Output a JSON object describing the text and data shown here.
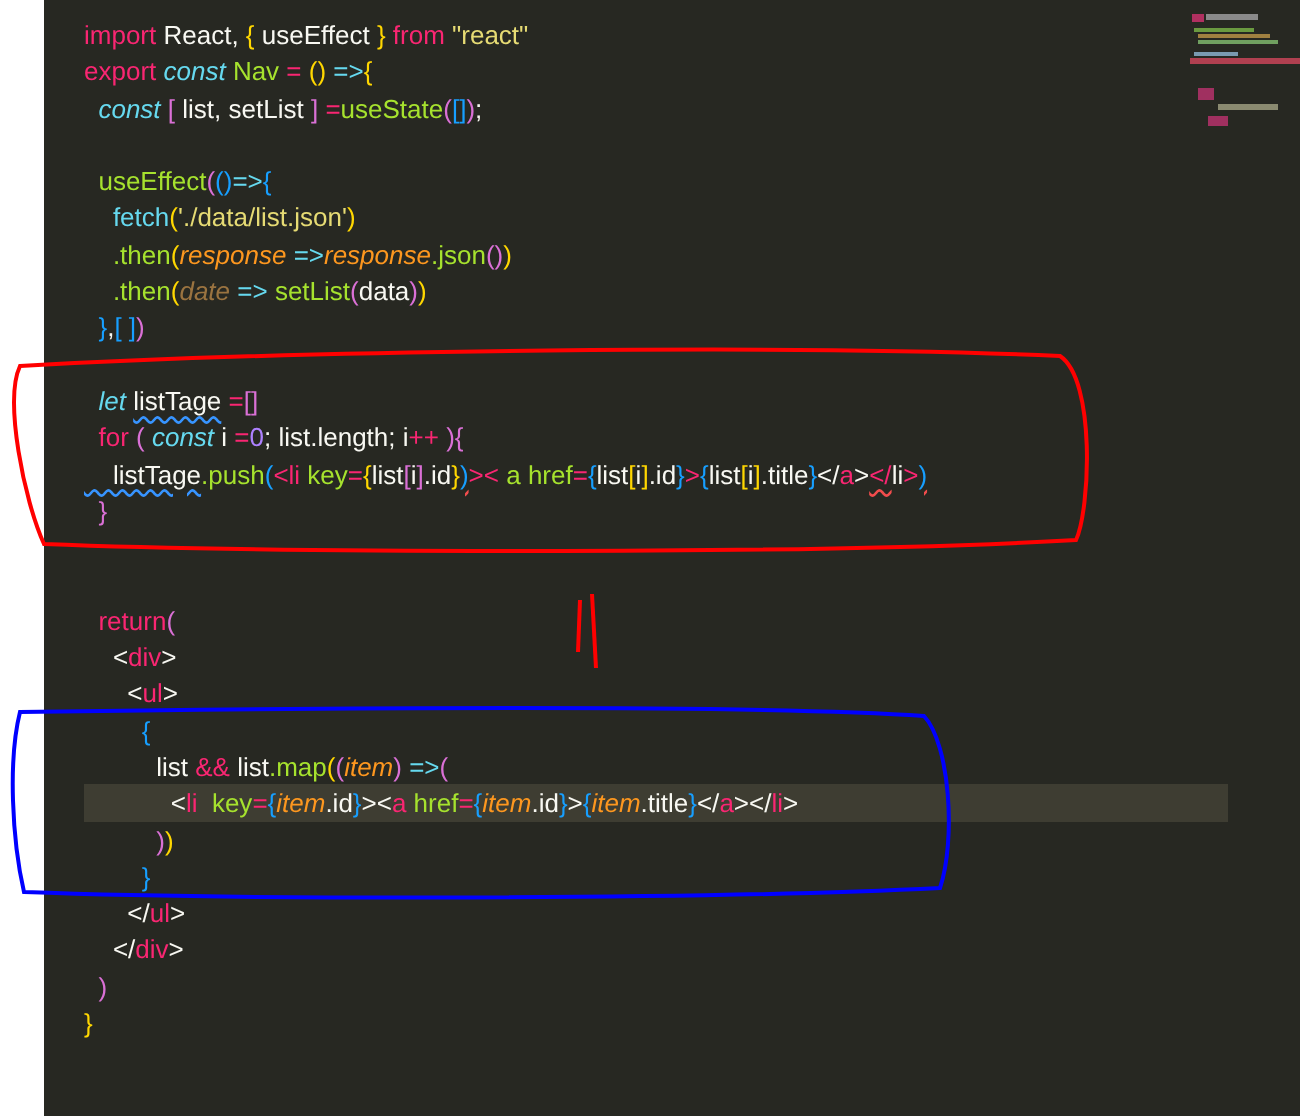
{
  "editor": {
    "lines": [
      {
        "current": false,
        "tokens": [
          {
            "text": "import",
            "kind": "kw"
          },
          {
            "text": " React, ",
            "kind": "plain"
          },
          {
            "text": "{",
            "kind": "b1"
          },
          {
            "text": " useEffect ",
            "kind": "plain"
          },
          {
            "text": "}",
            "kind": "b1"
          },
          {
            "text": " from ",
            "kind": "kw"
          },
          {
            "text": "\"react\"",
            "kind": "str"
          }
        ]
      },
      {
        "current": false,
        "tokens": [
          {
            "text": "export ",
            "kind": "kw"
          },
          {
            "text": "const",
            "kind": "storage"
          },
          {
            "text": " Nav ",
            "kind": "fn"
          },
          {
            "text": "= ",
            "kind": "op"
          },
          {
            "text": "()",
            "kind": "b1"
          },
          {
            "text": " =>",
            "kind": "arrow"
          },
          {
            "text": "{",
            "kind": "b1"
          }
        ]
      },
      {
        "current": false,
        "tokens": [
          {
            "text": "  const",
            "kind": "storage"
          },
          {
            "text": " [",
            "kind": "b2"
          },
          {
            "text": " list, setList ",
            "kind": "plain"
          },
          {
            "text": "]",
            "kind": "b2"
          },
          {
            "text": " =",
            "kind": "op"
          },
          {
            "text": "useState",
            "kind": "fn"
          },
          {
            "text": "(",
            "kind": "b2"
          },
          {
            "text": "[]",
            "kind": "b3"
          },
          {
            "text": ")",
            "kind": "b2"
          },
          {
            "text": ";",
            "kind": "plain"
          }
        ]
      },
      {
        "current": false
      },
      {
        "current": false,
        "tokens": [
          {
            "text": "  useEffect",
            "kind": "fn"
          },
          {
            "text": "(",
            "kind": "b2"
          },
          {
            "text": "()",
            "kind": "b3"
          },
          {
            "text": "=>",
            "kind": "arrow"
          },
          {
            "text": "{",
            "kind": "b3"
          }
        ]
      },
      {
        "current": false,
        "tokens": [
          {
            "text": "    fetch",
            "kind": "arrow"
          },
          {
            "text": "(",
            "kind": "b1"
          },
          {
            "text": "'./data/list.json'",
            "kind": "str"
          },
          {
            "text": ")",
            "kind": "b1"
          }
        ]
      },
      {
        "current": false,
        "tokens": [
          {
            "text": "    .then",
            "kind": "fn"
          },
          {
            "text": "(",
            "kind": "b1"
          },
          {
            "text": "response",
            "kind": "param"
          },
          {
            "text": " =>",
            "kind": "arrow"
          },
          {
            "text": "response",
            "kind": "param"
          },
          {
            "text": ".json",
            "kind": "fn"
          },
          {
            "text": "()",
            "kind": "b2"
          },
          {
            "text": ")",
            "kind": "b1"
          }
        ]
      },
      {
        "current": false,
        "tokens": [
          {
            "text": "    .then",
            "kind": "fn"
          },
          {
            "text": "(",
            "kind": "b1"
          },
          {
            "text": "date",
            "kind": "unused"
          },
          {
            "text": " =>",
            "kind": "arrow"
          },
          {
            "text": " setList",
            "kind": "fn"
          },
          {
            "text": "(",
            "kind": "b2"
          },
          {
            "text": "data",
            "kind": "plain"
          },
          {
            "text": ")",
            "kind": "b2"
          },
          {
            "text": ")",
            "kind": "b1"
          }
        ]
      },
      {
        "current": false,
        "tokens": [
          {
            "text": "  }",
            "kind": "b3"
          },
          {
            "text": ",",
            "kind": "plain"
          },
          {
            "text": "[ ]",
            "kind": "b3"
          },
          {
            "text": ")",
            "kind": "b2"
          }
        ]
      },
      {
        "current": false
      },
      {
        "current": false,
        "tokens": [
          {
            "text": "  let ",
            "kind": "storage"
          },
          {
            "text": "listTage",
            "kind": "plain",
            "warning": true
          },
          {
            "text": " =",
            "kind": "op"
          },
          {
            "text": "[]",
            "kind": "b2"
          }
        ]
      },
      {
        "current": false,
        "tokens": [
          {
            "text": "  for ",
            "kind": "kw"
          },
          {
            "text": "( ",
            "kind": "b2"
          },
          {
            "text": "const",
            "kind": "storage"
          },
          {
            "text": " i ",
            "kind": "plain"
          },
          {
            "text": "=",
            "kind": "op"
          },
          {
            "text": "0",
            "kind": "num"
          },
          {
            "text": "; list.length; i",
            "kind": "plain"
          },
          {
            "text": "++ ",
            "kind": "op"
          },
          {
            "text": ")",
            "kind": "b2"
          },
          {
            "text": "{",
            "kind": "b2"
          }
        ]
      },
      {
        "current": false,
        "tokens": [
          {
            "text": "    listTage",
            "kind": "plain",
            "warning": true
          },
          {
            "text": ".push",
            "kind": "fn"
          },
          {
            "text": "(",
            "kind": "b3"
          },
          {
            "text": "<li",
            "kind": "op"
          },
          {
            "text": " key",
            "kind": "fn"
          },
          {
            "text": "=",
            "kind": "op"
          },
          {
            "text": "{",
            "kind": "b1"
          },
          {
            "text": "list",
            "kind": "plain"
          },
          {
            "text": "[",
            "kind": "b2"
          },
          {
            "text": "i",
            "kind": "plain"
          },
          {
            "text": "]",
            "kind": "b2"
          },
          {
            "text": ".id",
            "kind": "plain"
          },
          {
            "text": "}",
            "kind": "b1"
          },
          {
            "text": ")",
            "kind": "b3",
            "error": true
          },
          {
            "text": ">",
            "kind": "op"
          },
          {
            "text": "<",
            "kind": "op"
          },
          {
            "text": " a href",
            "kind": "fn"
          },
          {
            "text": "=",
            "kind": "op"
          },
          {
            "text": "{",
            "kind": "b3"
          },
          {
            "text": "list",
            "kind": "plain"
          },
          {
            "text": "[",
            "kind": "b1"
          },
          {
            "text": "i",
            "kind": "plain"
          },
          {
            "text": "]",
            "kind": "b1"
          },
          {
            "text": ".id",
            "kind": "plain"
          },
          {
            "text": "}",
            "kind": "b3"
          },
          {
            "text": ">",
            "kind": "op"
          },
          {
            "text": "{",
            "kind": "b3"
          },
          {
            "text": "list",
            "kind": "plain"
          },
          {
            "text": "[",
            "kind": "b1"
          },
          {
            "text": "i",
            "kind": "plain"
          },
          {
            "text": "]",
            "kind": "b1"
          },
          {
            "text": ".title",
            "kind": "plain"
          },
          {
            "text": "}",
            "kind": "b3"
          },
          {
            "text": "</",
            "kind": "plain"
          },
          {
            "text": "a",
            "kind": "op"
          },
          {
            "text": ">",
            "kind": "plain"
          },
          {
            "text": "</",
            "kind": "op",
            "error": true
          },
          {
            "text": "li",
            "kind": "plain"
          },
          {
            "text": ">",
            "kind": "op"
          },
          {
            "text": ")",
            "kind": "b3",
            "error": true
          }
        ]
      },
      {
        "current": false,
        "tokens": [
          {
            "text": "  }",
            "kind": "b2"
          }
        ]
      },
      {
        "current": false
      },
      {
        "current": false
      },
      {
        "current": false,
        "tokens": [
          {
            "text": "  return",
            "kind": "kw"
          },
          {
            "text": "(",
            "kind": "b2"
          }
        ]
      },
      {
        "current": false,
        "tokens": [
          {
            "text": "    <",
            "kind": "plain"
          },
          {
            "text": "div",
            "kind": "op"
          },
          {
            "text": ">",
            "kind": "plain"
          }
        ]
      },
      {
        "current": false,
        "tokens": [
          {
            "text": "      <",
            "kind": "plain"
          },
          {
            "text": "ul",
            "kind": "op"
          },
          {
            "text": ">",
            "kind": "plain"
          }
        ]
      },
      {
        "current": false,
        "tokens": [
          {
            "text": "        {",
            "kind": "b3"
          }
        ]
      },
      {
        "current": false,
        "tokens": [
          {
            "text": "          list ",
            "kind": "plain"
          },
          {
            "text": "&&",
            "kind": "op"
          },
          {
            "text": " list",
            "kind": "plain"
          },
          {
            "text": ".map",
            "kind": "fn"
          },
          {
            "text": "(",
            "kind": "b1"
          },
          {
            "text": "(",
            "kind": "b2"
          },
          {
            "text": "item",
            "kind": "param"
          },
          {
            "text": ")",
            "kind": "b2"
          },
          {
            "text": " =>",
            "kind": "arrow"
          },
          {
            "text": "(",
            "kind": "b2"
          }
        ]
      },
      {
        "current": true,
        "tokens": [
          {
            "text": "            <",
            "kind": "plain"
          },
          {
            "text": "li",
            "kind": "op"
          },
          {
            "text": "  key",
            "kind": "fn"
          },
          {
            "text": "=",
            "kind": "op"
          },
          {
            "text": "{",
            "kind": "b3"
          },
          {
            "text": "item",
            "kind": "param"
          },
          {
            "text": ".id",
            "kind": "plain"
          },
          {
            "text": "}",
            "kind": "b3"
          },
          {
            "text": ">",
            "kind": "plain"
          },
          {
            "text": "<",
            "kind": "plain"
          },
          {
            "text": "a",
            "kind": "op"
          },
          {
            "text": " href",
            "kind": "fn"
          },
          {
            "text": "=",
            "kind": "op"
          },
          {
            "text": "{",
            "kind": "b3"
          },
          {
            "text": "item",
            "kind": "param"
          },
          {
            "text": ".id",
            "kind": "plain"
          },
          {
            "text": "}",
            "kind": "b3"
          },
          {
            "text": ">",
            "kind": "plain"
          },
          {
            "text": "{",
            "kind": "b3"
          },
          {
            "text": "item",
            "kind": "param"
          },
          {
            "text": ".title",
            "kind": "plain"
          },
          {
            "text": "}",
            "kind": "b3"
          },
          {
            "text": "</",
            "kind": "plain"
          },
          {
            "text": "a",
            "kind": "op"
          },
          {
            "text": "></",
            "kind": "plain"
          },
          {
            "text": "li",
            "kind": "op"
          },
          {
            "text": ">",
            "kind": "plain"
          }
        ]
      },
      {
        "current": false,
        "tokens": [
          {
            "text": "          )",
            "kind": "b2"
          },
          {
            "text": ")",
            "kind": "b1"
          }
        ]
      },
      {
        "current": false,
        "tokens": [
          {
            "text": "        }",
            "kind": "b3"
          }
        ]
      },
      {
        "current": false,
        "tokens": [
          {
            "text": "      </",
            "kind": "plain"
          },
          {
            "text": "ul",
            "kind": "op"
          },
          {
            "text": ">",
            "kind": "plain"
          }
        ]
      },
      {
        "current": false,
        "tokens": [
          {
            "text": "    </",
            "kind": "plain"
          },
          {
            "text": "div",
            "kind": "op"
          },
          {
            "text": ">",
            "kind": "plain"
          }
        ]
      },
      {
        "current": false,
        "tokens": [
          {
            "text": "  )",
            "kind": "b2"
          }
        ]
      },
      {
        "current": false,
        "tokens": [
          {
            "text": "}",
            "kind": "b1"
          }
        ]
      }
    ]
  }
}
